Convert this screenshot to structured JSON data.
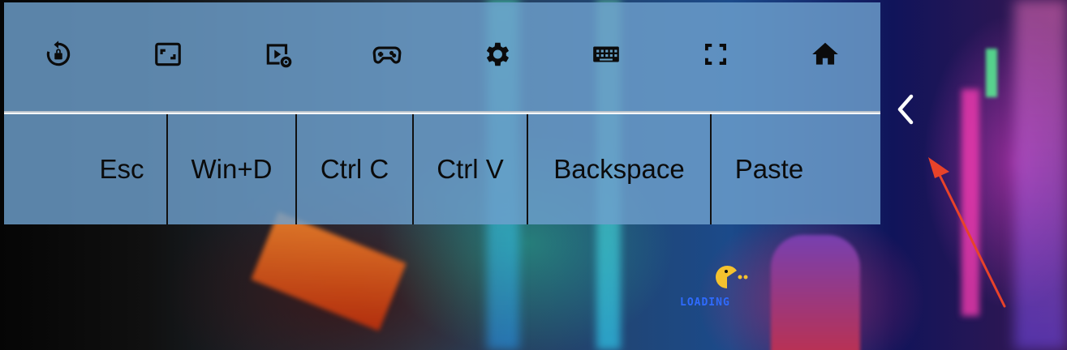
{
  "toolbar": {
    "icons": [
      {
        "name": "lock-rotation-icon"
      },
      {
        "name": "fit-screen-icon"
      },
      {
        "name": "video-settings-icon"
      },
      {
        "name": "gamepad-icon"
      },
      {
        "name": "settings-gear-icon"
      },
      {
        "name": "keyboard-icon"
      },
      {
        "name": "fullscreen-icon"
      },
      {
        "name": "home-icon"
      }
    ],
    "keys": [
      "Esc",
      "Win+D",
      "Ctrl C",
      "Ctrl V",
      "Backspace",
      "Paste"
    ]
  },
  "loading": {
    "label": "LOADING"
  },
  "colors": {
    "panel": "#6ea0cd",
    "icon": "#0b0b0b",
    "annotation_arrow": "#e8432a",
    "loading_text": "#2f6bff"
  }
}
